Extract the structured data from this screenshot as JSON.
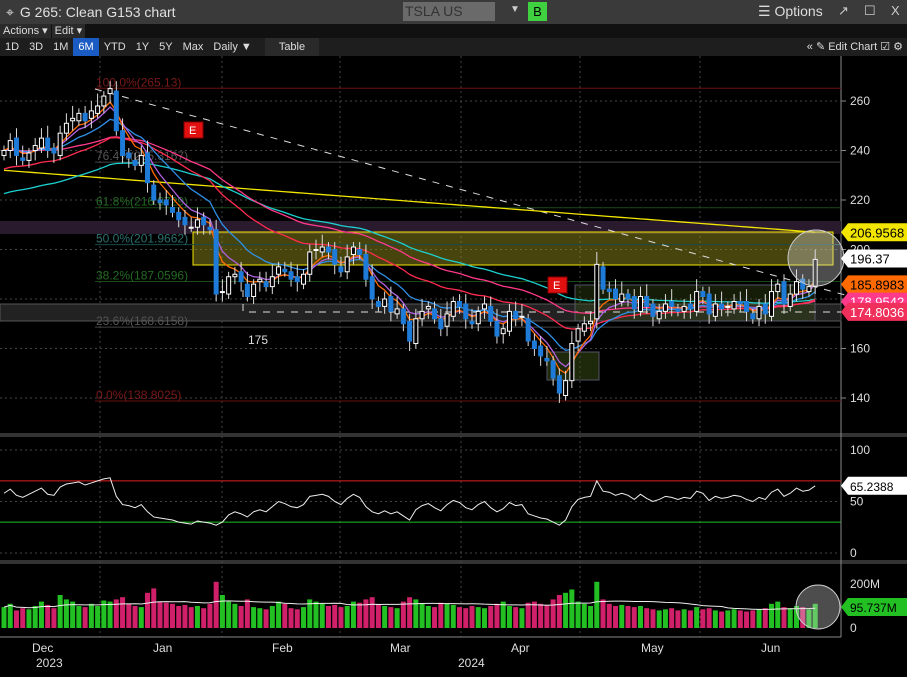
{
  "window": {
    "title": "G 265: Clean G153 chart",
    "security": "TSLA US Equity",
    "b_label": "B",
    "options": "☰ Options",
    "popout": "↗",
    "maximize": "☐",
    "close": "X",
    "move_icon": "⌖"
  },
  "menu": {
    "actions": "Actions ▾",
    "edit": "Edit ▾"
  },
  "toolbar": {
    "ranges": [
      "1D",
      "3D",
      "1M",
      "6M",
      "YTD",
      "1Y",
      "5Y",
      "Max"
    ],
    "active": "6M",
    "period": "Daily ▼",
    "table": "Table",
    "collapse": "«",
    "edit_chart": "✎ Edit Chart",
    "icons": [
      "☑",
      "⚙"
    ]
  },
  "colors": {
    "up": "#ffffff",
    "down": "#1e7bd8",
    "vol_up": "#22c022",
    "vol_down": "#d0206a",
    "yellow": "#f2e600",
    "orange": "#ff6a00",
    "pink": "#ff3a8a",
    "red": "#ff2b4f",
    "cyan": "#1ecfcf",
    "blue": "#2f8fe6",
    "purple": "#b060e0"
  },
  "chart_data": {
    "type": "candlestick",
    "ylim": [
      130,
      275
    ],
    "y_ticks": [
      140,
      160,
      180,
      200,
      220,
      240,
      260
    ],
    "months": [
      "Dec",
      "Jan",
      "Feb",
      "Mar",
      "Apr",
      "May",
      "Jun"
    ],
    "years": [
      "2023",
      "2024"
    ],
    "close": [
      240,
      244,
      238,
      236,
      239,
      242,
      245,
      240,
      239,
      247,
      251,
      253,
      255,
      252,
      256,
      258,
      262,
      265,
      248,
      238,
      237,
      234,
      238,
      227,
      220,
      219,
      218,
      215,
      212,
      210,
      209,
      212,
      210,
      208,
      182,
      183,
      189,
      190,
      187,
      181,
      186,
      188,
      185,
      189,
      193,
      191,
      188,
      187,
      190,
      199,
      200,
      201,
      199,
      194,
      191,
      197,
      201,
      198,
      188,
      180,
      177,
      180,
      175,
      176,
      170,
      163,
      172,
      175,
      177,
      172,
      168,
      174,
      179,
      177,
      172,
      170,
      175,
      178,
      171,
      165,
      168,
      175,
      172,
      173,
      163,
      160,
      157,
      155,
      148,
      142,
      147,
      162,
      168,
      170,
      171,
      194,
      184,
      183,
      180,
      182,
      180,
      176,
      181,
      177,
      173,
      175,
      178,
      177,
      175,
      177,
      176,
      183,
      181,
      174,
      178,
      176,
      177,
      179,
      178,
      175,
      172,
      177,
      174,
      183,
      186,
      178,
      182,
      187,
      184,
      185,
      196
    ],
    "volume": [
      95,
      110,
      80,
      90,
      85,
      100,
      120,
      105,
      90,
      150,
      130,
      120,
      100,
      95,
      110,
      100,
      125,
      120,
      130,
      140,
      110,
      100,
      95,
      160,
      180,
      120,
      115,
      110,
      100,
      105,
      95,
      100,
      90,
      110,
      210,
      150,
      120,
      110,
      100,
      130,
      95,
      90,
      85,
      100,
      120,
      110,
      90,
      85,
      95,
      130,
      120,
      110,
      100,
      105,
      95,
      100,
      120,
      115,
      130,
      140,
      110,
      100,
      95,
      90,
      120,
      140,
      130,
      110,
      100,
      95,
      115,
      110,
      105,
      95,
      90,
      100,
      95,
      90,
      100,
      110,
      120,
      100,
      95,
      90,
      115,
      120,
      110,
      105,
      130,
      150,
      160,
      175,
      120,
      110,
      100,
      210,
      130,
      110,
      100,
      105,
      100,
      95,
      100,
      90,
      85,
      80,
      85,
      90,
      80,
      85,
      80,
      95,
      85,
      90,
      80,
      75,
      80,
      85,
      80,
      75,
      80,
      85,
      90,
      110,
      120,
      95,
      90,
      100,
      95,
      85,
      110
    ],
    "rsi": [
      58,
      62,
      56,
      54,
      57,
      60,
      63,
      57,
      56,
      64,
      67,
      68,
      69,
      66,
      68,
      70,
      72,
      73,
      55,
      47,
      46,
      44,
      47,
      40,
      35,
      34,
      33,
      32,
      30,
      29,
      28,
      31,
      30,
      29,
      27,
      30,
      37,
      40,
      38,
      35,
      40,
      42,
      40,
      45,
      50,
      48,
      45,
      44,
      47,
      55,
      56,
      57,
      55,
      50,
      47,
      53,
      57,
      54,
      45,
      40,
      38,
      41,
      38,
      40,
      36,
      32,
      42,
      46,
      48,
      44,
      41,
      47,
      51,
      49,
      44,
      42,
      47,
      50,
      44,
      40,
      43,
      49,
      46,
      47,
      38,
      36,
      34,
      33,
      30,
      27,
      32,
      45,
      52,
      54,
      55,
      70,
      60,
      59,
      56,
      58,
      56,
      52,
      57,
      53,
      50,
      52,
      55,
      54,
      52,
      54,
      53,
      60,
      58,
      51,
      55,
      53,
      54,
      56,
      55,
      52,
      50,
      54,
      52,
      59,
      62,
      55,
      58,
      63,
      60,
      61,
      65.24
    ],
    "rsi_ticks": [
      0,
      50,
      100
    ],
    "rsi_levels": [
      30,
      70
    ],
    "vol_ticks": [
      "0",
      "200M"
    ],
    "last_values": {
      "ma_yellow": "206.9568",
      "price": "196.37",
      "ma_orange": "185.8983",
      "ma_pink": "178.9542",
      "ma_red": "174.8036",
      "rsi": "65.2388",
      "volume": "95.737M"
    },
    "fib": [
      {
        "label": "100.0%(265.13)",
        "value": 265.13
      },
      {
        "label": "76.4%(235.3167)",
        "value": 235.3167
      },
      {
        "label": "61.8%(216.8729)",
        "value": 216.8729
      },
      {
        "label": "50.0%(201.9662)",
        "value": 201.9662
      },
      {
        "label": "38.2%(187.0596)",
        "value": 187.0596
      },
      {
        "label": "23.6%(168.6158)",
        "value": 168.6158
      },
      {
        "label": "0.0%(138.8025)",
        "value": 138.8025
      }
    ],
    "annotation_175": "175",
    "earnings_marker": "E"
  }
}
